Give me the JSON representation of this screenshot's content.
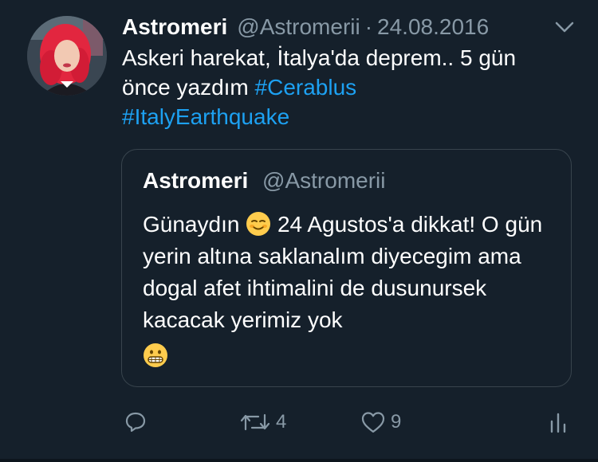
{
  "tweet": {
    "author_name": "Astromeri",
    "author_handle": "@Astromerii",
    "separator": "·",
    "date": "24.08.2016",
    "text_line1": "Askeri harekat, İtalya'da deprem.. 5 gün",
    "text_line2": "önce yazdım",
    "hashtag1": "#Cerablus",
    "hashtag2": "#ItalyEarthquake"
  },
  "quoted_tweet": {
    "author_name": "Astromeri",
    "author_handle": "@Astromerii",
    "text_part1": "Günaydın",
    "text_part2": "24 Agustos'a dikkat! O gün yerin altına saklanalım diyecegim ama dogal afet ihtimalini de dusunursek kacacak yerimiz yok",
    "emoji1": "relieved-smiling-face",
    "emoji2": "grimacing-face"
  },
  "actions": {
    "reply_count": "",
    "retweet_count": "4",
    "like_count": "9"
  },
  "colors": {
    "background": "#15202b",
    "text": "#ffffff",
    "muted": "#8899a6",
    "link": "#1da1f2",
    "border": "#38444d"
  }
}
